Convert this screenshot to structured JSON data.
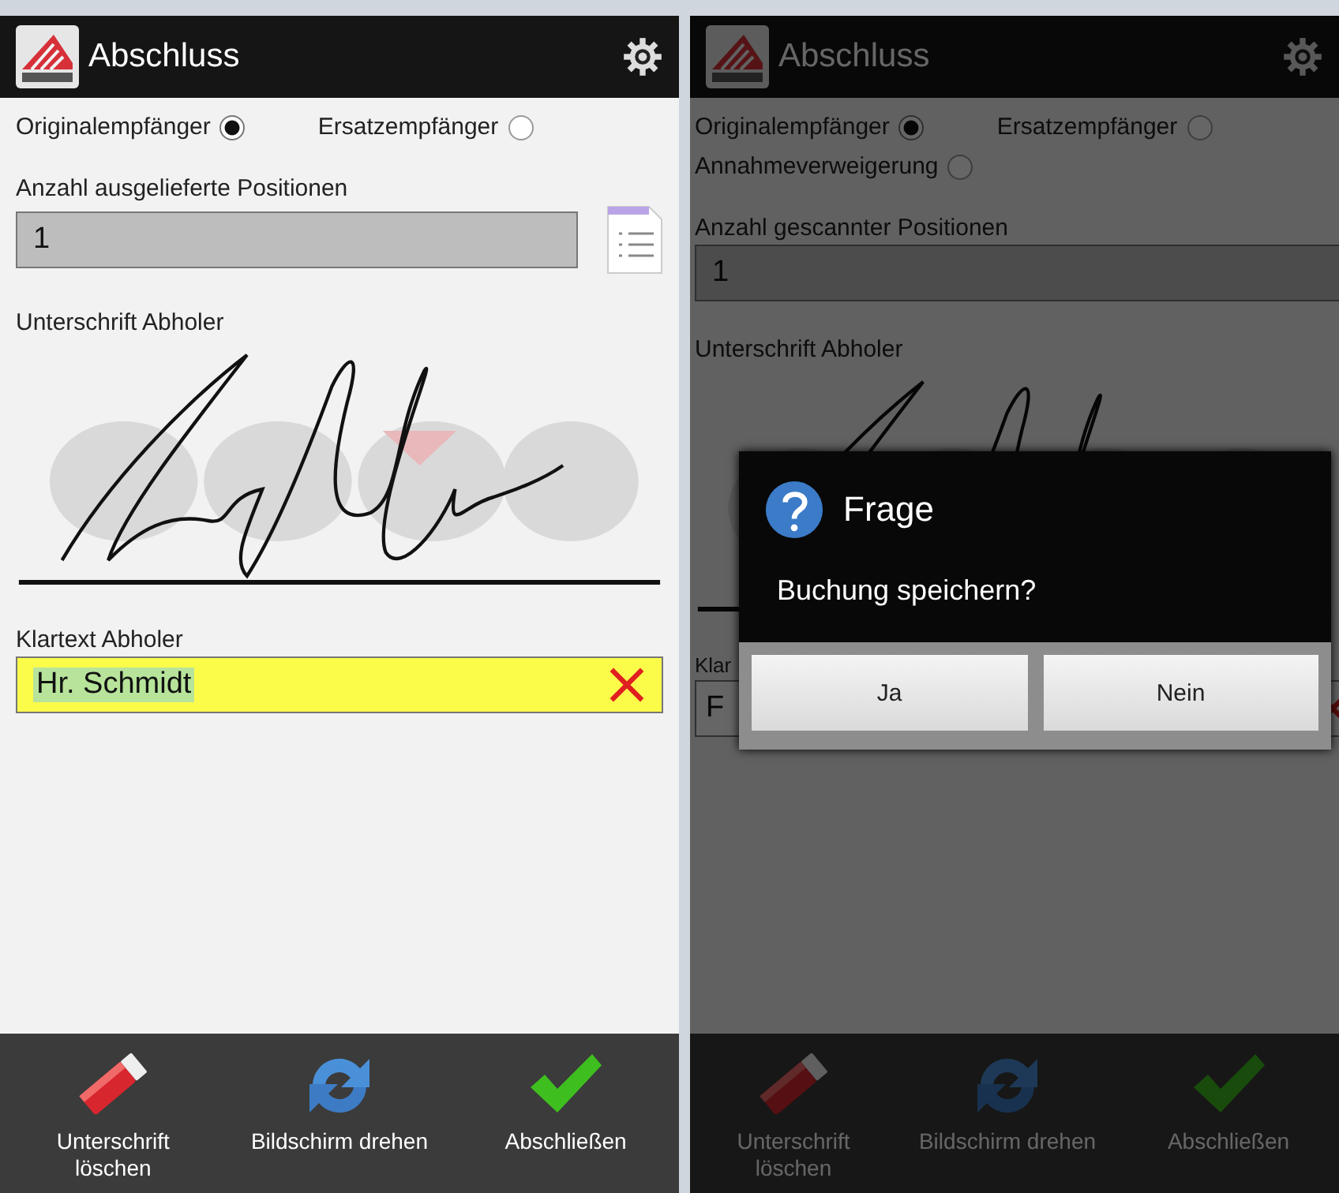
{
  "screens": [
    {
      "title": "Abschluss",
      "dimmed": false,
      "recipients": [
        {
          "label": "Originalempfänger",
          "selected": true
        },
        {
          "label": "Ersatzempfänger",
          "selected": false
        }
      ],
      "positions": {
        "label": "Anzahl ausgelieferte Positionen",
        "value": "1",
        "list_button": true
      },
      "signature": {
        "label": "Unterschrift Abholer"
      },
      "name": {
        "label": "Klartext Abholer",
        "value": "Hr. Schmidt",
        "highlighted": true,
        "clear_button": true
      },
      "toolbar": [
        {
          "kind": "erase",
          "label": "Unterschrift löschen"
        },
        {
          "kind": "rotate",
          "label": "Bildschirm drehen"
        },
        {
          "kind": "finish",
          "label": "Abschließen"
        }
      ]
    },
    {
      "title": "Abschluss",
      "dimmed": true,
      "recipients": [
        {
          "label": "Originalempfänger",
          "selected": true
        },
        {
          "label": "Ersatzempfänger",
          "selected": false
        },
        {
          "label": "Annahmeverweigerung",
          "selected": false
        }
      ],
      "positions": {
        "label": "Anzahl gescannter Positionen",
        "value": "1",
        "list_button": false
      },
      "signature": {
        "label": "Unterschrift Abholer"
      },
      "name": {
        "label": "Klar",
        "value": "F",
        "highlighted": false,
        "clear_button": true
      },
      "toolbar": [
        {
          "kind": "erase",
          "label": "Unterschrift löschen"
        },
        {
          "kind": "rotate",
          "label": "Bildschirm drehen"
        },
        {
          "kind": "finish",
          "label": "Abschließen"
        }
      ],
      "dialog": {
        "title": "Frage",
        "message": "Buchung speichern?",
        "buttons": [
          "Ja",
          "Nein"
        ]
      }
    }
  ]
}
